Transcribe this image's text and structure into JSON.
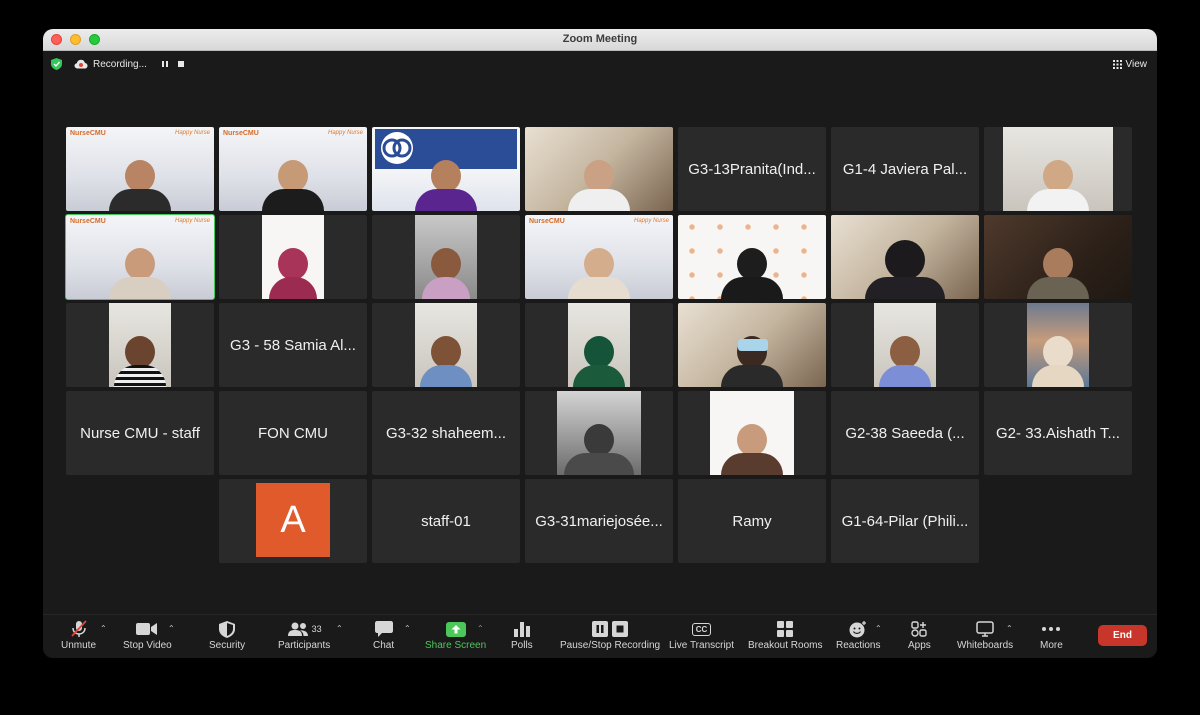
{
  "window": {
    "title": "Zoom Meeting"
  },
  "topbar": {
    "recording_label": "Recording...",
    "view_label": "View"
  },
  "tiles": {
    "r1c5": "G3-13Pranita(Ind...",
    "r1c6": "G1-4 Javiera Pal...",
    "r3c2": "G3 - 58 Samia Al...",
    "r4c1": "Nurse CMU - staff",
    "r4c2": "FON CMU",
    "r4c3": "G3-32 shaheem...",
    "r4c6": "G2-38 Saeeda (...",
    "r4c7": "G2- 33.Aishath T...",
    "r5c2_initial": "A",
    "r5c3": "staff-01",
    "r5c4": "G3-31mariejosée...",
    "r5c5": "Ramy",
    "r5c6": "G1-64-Pilar (Phili..."
  },
  "slide_branding": {
    "left": "NurseCMU",
    "right": "Happy Nurse"
  },
  "toolbar": {
    "unmute": "Unmute",
    "stop_video": "Stop Video",
    "security": "Security",
    "participants": "Participants",
    "participants_count": "33",
    "chat": "Chat",
    "share_screen": "Share Screen",
    "polls": "Polls",
    "pause_stop_recording": "Pause/Stop Recording",
    "live_transcript": "Live Transcript",
    "cc_badge": "CC",
    "breakout_rooms": "Breakout Rooms",
    "reactions": "Reactions",
    "apps": "Apps",
    "whiteboards": "Whiteboards",
    "more": "More",
    "end": "End"
  },
  "colors": {
    "accent_green": "#42c95a",
    "end_red": "#c7352b",
    "avatar_orange": "#e05a2b",
    "tile_bg": "#2a2a2a"
  }
}
